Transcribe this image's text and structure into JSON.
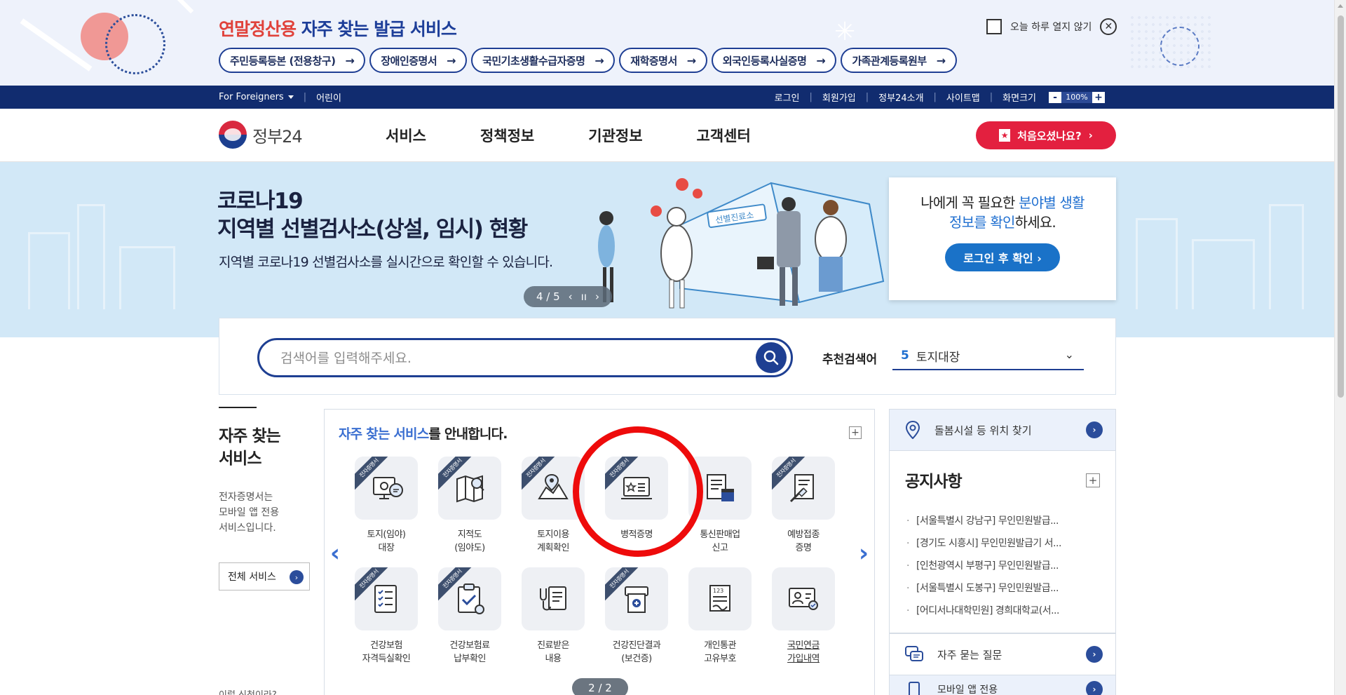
{
  "promo": {
    "title_highlight": "연말정산용",
    "title_rest": " 자주 찾는 발급 서비스",
    "links": [
      {
        "label": "주민등록등본 (전용창구)",
        "arrow": "→"
      },
      {
        "label": "장애인증명서",
        "arrow": "→"
      },
      {
        "label": "국민기초생활수급자증명",
        "arrow": "→"
      },
      {
        "label": "재학증명서",
        "arrow": "→"
      },
      {
        "label": "외국인등록사실증명",
        "arrow": "→"
      },
      {
        "label": "가족관계등록원부",
        "arrow": "→"
      }
    ],
    "close_today_label": "오늘 하루 열지 않기",
    "close_icon": "✕"
  },
  "utilbar": {
    "foreigners": "For Foreigners",
    "kids": "어린이",
    "links": [
      "로그인",
      "회원가입",
      "정부24소개",
      "사이트맵"
    ],
    "zoom_label": "화면크기",
    "zoom_minus": "-",
    "zoom_value": "100%",
    "zoom_plus": "+"
  },
  "header": {
    "logo_text": "정부24",
    "nav": [
      "서비스",
      "정책정보",
      "기관정보",
      "고객센터"
    ],
    "first_visit_button": "처음오셨나요?",
    "first_visit_arrow": "›"
  },
  "hero": {
    "title_line1": "코로나19",
    "title_line2": "지역별 선별검사소(상설, 임시) 현황",
    "description": "지역별 코로나19 선별검사소를 실시간으로 확인할 수 있습니다.",
    "slide_counter": "4 / 5",
    "prev": "‹",
    "pause": "ıı",
    "next": "›",
    "tent_sign": "선별진료소",
    "login_card": {
      "msg_prefix": "나에게 꼭 필요한 ",
      "msg_highlight1": "분야별 생활",
      "msg_highlight2": "정보를 확인",
      "msg_suffix": "하세요.",
      "button": "로그인 후 확인 ›"
    }
  },
  "search": {
    "placeholder": "검색어를 입력해주세요.",
    "recommend_label": "추천검색어",
    "recommend_num": "5",
    "recommend_term": "토지대장",
    "chevron": "⌄"
  },
  "left": {
    "title_line1": "자주 찾는",
    "title_line2": "서비스",
    "desc_line1": "전자증명서는",
    "desc_line2": "모바일 앱 전용",
    "desc_line3": "서비스입니다.",
    "all_services": "전체 서비스",
    "all_arrow": "›",
    "howto": "이럴 신청이라?"
  },
  "services": {
    "head_highlight": "자주 찾는 서비스",
    "head_rest": "를 안내합니다.",
    "plus": "+",
    "prev": "‹",
    "next": "›",
    "ribbon": "전자증명서",
    "items": [
      {
        "label": "토지(임야)\n대장",
        "badge": true,
        "icon": "land-register-icon"
      },
      {
        "label": "지적도\n(임야도)",
        "badge": true,
        "icon": "cadastral-map-icon"
      },
      {
        "label": "토지이용\n계획확인",
        "badge": true,
        "icon": "land-use-icon"
      },
      {
        "label": "병적증명",
        "badge": true,
        "icon": "military-record-icon"
      },
      {
        "label": "통신판매업\n신고",
        "badge": false,
        "icon": "mail-order-icon"
      },
      {
        "label": "예방접종\n증명",
        "badge": true,
        "icon": "vaccination-icon"
      },
      {
        "label": "건강보험\n자격득실확인",
        "badge": true,
        "icon": "health-insurance-icon"
      },
      {
        "label": "건강보험료\n납부확인",
        "badge": true,
        "icon": "insurance-payment-icon"
      },
      {
        "label": "진료받은\n내용",
        "badge": false,
        "icon": "medical-record-icon"
      },
      {
        "label": "건강진단결과\n(보건증)",
        "badge": true,
        "icon": "health-check-icon"
      },
      {
        "label": "개인통관\n고유부호",
        "badge": false,
        "icon": "customs-code-icon"
      },
      {
        "label": "국민연금\n가입내역",
        "badge": false,
        "icon": "pension-icon"
      }
    ],
    "page_indicator": "2 / 2"
  },
  "right": {
    "location_search": "돌봄시설 등 위치 찾기",
    "notice_title": "공지사항",
    "notice_plus": "+",
    "notices": [
      "[서울특별시 강남구] 무인민원발급...",
      "[경기도 시흥시] 무인민원발급기 서...",
      "[인천광역시 부평구] 무인민원발급...",
      "[서울특별시 도봉구] 무인민원발급...",
      "[어디서나대학민원] 경희대학교(서..."
    ],
    "faq": "자주 묻는 질문",
    "mobile_app": "모바일 앱 전용",
    "arrow": "›"
  },
  "colors": {
    "brand_navy": "#112c6f",
    "accent_blue": "#1e3f92",
    "accent_red": "#e3203f",
    "hero_bg": "#d2e8f7",
    "highlight_ring": "#ee0b0b"
  }
}
